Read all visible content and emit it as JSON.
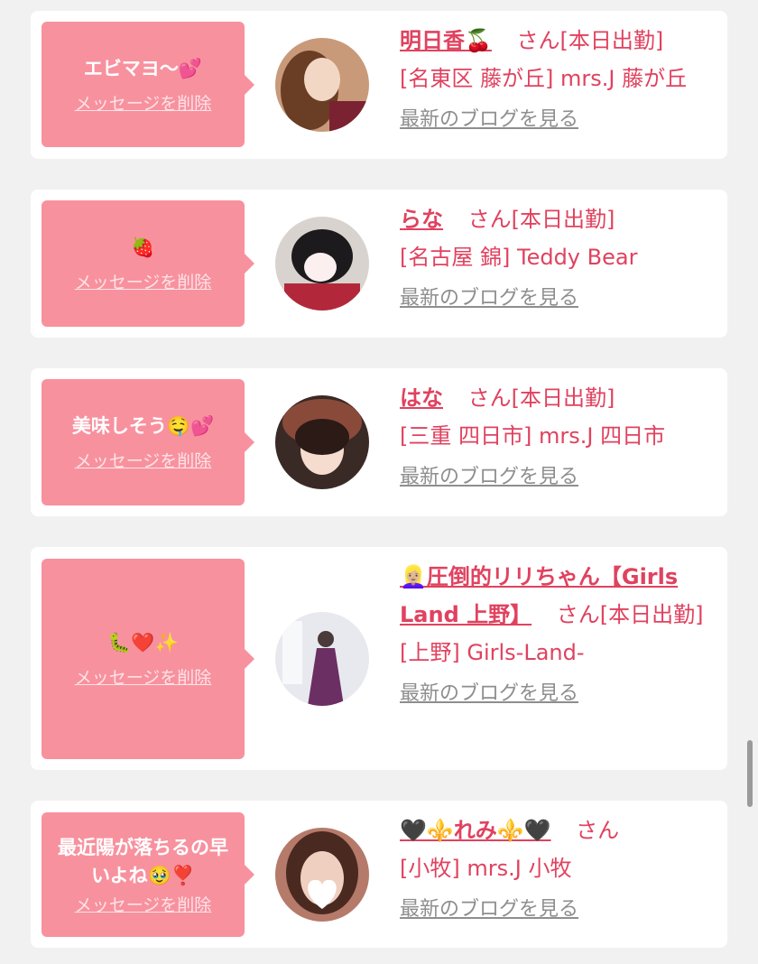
{
  "entries": [
    {
      "message": "エビマヨ〜💕",
      "delete_label": "メッセージを削除",
      "name": "明日香🍒",
      "suffix": "さん[本日出勤]",
      "shop": "[名東区 藤が丘] mrs.J 藤が丘",
      "blog_label": "最新のブログを見る"
    },
    {
      "message": "🍓",
      "delete_label": "メッセージを削除",
      "name": "らな",
      "suffix": "さん[本日出勤]",
      "shop": "[名古屋 錦] Teddy Bear",
      "blog_label": "最新のブログを見る"
    },
    {
      "message": "美味しそう🤤💕",
      "delete_label": "メッセージを削除",
      "name": "はな",
      "suffix": "さん[本日出勤]",
      "shop": "[三重 四日市] mrs.J 四日市",
      "blog_label": "最新のブログを見る"
    },
    {
      "message": "🐛❤️✨",
      "delete_label": "メッセージを削除",
      "name": "👱🏼‍♀️圧倒的リリちゃん【Girls Land 上野】",
      "suffix": "さん[本日出勤]",
      "shop": "[上野] Girls-Land-",
      "blog_label": "最新のブログを見る"
    },
    {
      "message": "最近陽が落ちるの早いよね🥹❣️",
      "delete_label": "メッセージを削除",
      "name": "🖤⚜️れみ⚜️🖤",
      "suffix": "さん",
      "shop": "[小牧] mrs.J 小牧",
      "blog_label": "最新のブログを見る"
    }
  ],
  "colors": {
    "accent": "#e0425f",
    "bubble": "#f8919e",
    "background": "#f1f1f1",
    "link_gray": "#8e8e8e"
  }
}
